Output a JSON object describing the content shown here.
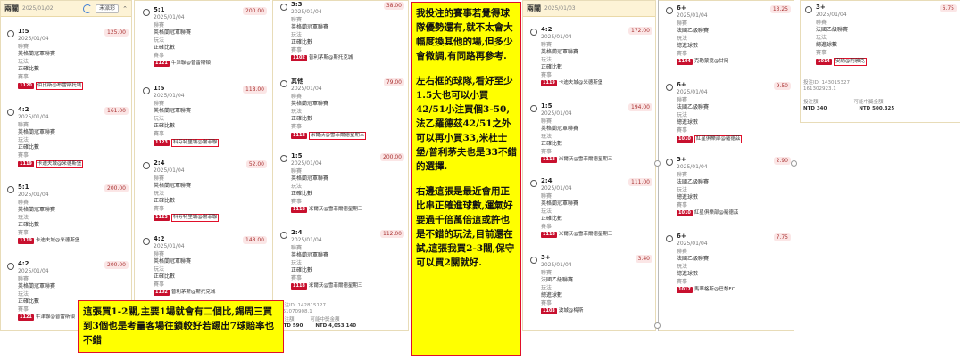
{
  "col1": {
    "title": "兩關",
    "date": "2025/01/02",
    "button": "未派彩",
    "bets": [
      {
        "score": "1:5",
        "date": "2025/01/04",
        "league_label": "聯賽",
        "league": "英格蘭冠軍聯賽",
        "play_label": "玩法",
        "play": "正確比數",
        "match_label": "賽事",
        "match_id": "1120",
        "match": "伯比斯@布雷斯托域",
        "amount": "125.00"
      },
      {
        "score": "4:2",
        "date": "2025/01/04",
        "league_label": "聯賽",
        "league": "英格蘭冠軍聯賽",
        "play_label": "玩法",
        "play": "正確比數",
        "match_label": "賽事",
        "match_id": "1119",
        "match": "卡迪夫城@米德斯堡",
        "amount": "161.00"
      },
      {
        "score": "5:1",
        "date": "2025/01/04",
        "league_label": "聯賽",
        "league": "英格蘭冠軍聯賽",
        "play_label": "玩法",
        "play": "正確比數",
        "match_label": "賽事",
        "match_id": "1119",
        "match": "卡迪夫城@米德斯堡",
        "amount": "200.00"
      },
      {
        "score": "4:2",
        "date": "2025/01/04",
        "league_label": "聯賽",
        "league": "英格蘭冠軍聯賽",
        "play_label": "玩法",
        "play": "正確比數",
        "match_label": "賽事",
        "match_id": "1121",
        "match": "牛津聯@普雷斯頓",
        "amount": "200.00"
      }
    ]
  },
  "col2": {
    "bets": [
      {
        "score": "5:1",
        "date": "2025/01/04",
        "league_label": "聯賽",
        "league": "英格蘭冠軍聯賽",
        "play_label": "玩法",
        "play": "正確比數",
        "match_label": "賽事",
        "match_id": "1121",
        "match": "牛津聯@普雷斯頓",
        "amount": "200.00"
      },
      {
        "score": "1:5",
        "date": "2025/01/04",
        "league_label": "聯賽",
        "league": "英格蘭冠軍聯賽",
        "play_label": "玩法",
        "play": "正確比數",
        "match_label": "賽事",
        "match_id": "1123",
        "match": "科芬特里城@謝菲聯",
        "amount": "118.00"
      },
      {
        "score": "2:4",
        "date": "2025/01/04",
        "league_label": "聯賽",
        "league": "英格蘭冠軍聯賽",
        "play_label": "玩法",
        "play": "正確比數",
        "match_label": "賽事",
        "match_id": "1123",
        "match": "科芬特里城@謝菲聯",
        "amount": "52.00"
      },
      {
        "score": "4:2",
        "date": "2025/01/04",
        "league_label": "聯賽",
        "league": "英格蘭冠軍聯賽",
        "play_label": "玩法",
        "play": "正確比數",
        "match_label": "賽事",
        "match_id": "1102",
        "match": "普利茅斯@斯托克城",
        "amount": "148.00"
      }
    ]
  },
  "col3": {
    "bets": [
      {
        "score": "3:3",
        "date": "2025/01/04",
        "league_label": "聯賽",
        "league": "英格蘭冠軍聯賽",
        "play_label": "玩法",
        "play": "正確比數",
        "match_label": "賽事",
        "match_id": "1102",
        "match": "普利茅斯@斯托克城",
        "amount": "38.00"
      },
      {
        "score": "其他",
        "date": "2025/01/04",
        "league_label": "聯賽",
        "league": "英格蘭冠軍聯賽",
        "play_label": "玩法",
        "play": "正確比數",
        "match_label": "賽事",
        "match_id": "1118",
        "match": "米爾沃@雪菲爾德星期三",
        "amount": "79.00"
      },
      {
        "score": "1:5",
        "date": "2025/01/04",
        "league_label": "聯賽",
        "league": "英格蘭冠軍聯賽",
        "play_label": "玩法",
        "play": "正確比數",
        "match_label": "賽事",
        "match_id": "1118",
        "match": "米爾沃@雪菲爾德星期三",
        "amount": "200.00"
      },
      {
        "score": "2:4",
        "date": "2025/01/04",
        "league_label": "聯賽",
        "league": "英格蘭冠軍聯賽",
        "play_label": "玩法",
        "play": "正確比數",
        "match_label": "賽事",
        "match_id": "1118",
        "match": "米爾沃@雪菲爾德星期三",
        "amount": "112.00"
      }
    ],
    "footer": {
      "id_label": "投注ID:",
      "id1": "142815127",
      "id2": "161070908.1",
      "stake_label": "投注額",
      "stake": "NTD 590",
      "win_label": "可能中獎金額",
      "win": "NTD 4,053.140"
    }
  },
  "col4": {
    "title": "兩關",
    "date": "2025/01/03",
    "button": "未派彩",
    "bets": [
      {
        "score": "4:2",
        "date": "2025/01/04",
        "league_label": "聯賽",
        "league": "英格蘭冠軍聯賽",
        "play_label": "玩法",
        "play": "正確比數",
        "match_label": "賽事",
        "match_id": "1119",
        "match": "卡迪夫城@米德斯堡",
        "amount": "172.00"
      },
      {
        "score": "1:5",
        "date": "2025/01/04",
        "league_label": "聯賽",
        "league": "英格蘭冠軍聯賽",
        "play_label": "玩法",
        "play": "正確比數",
        "match_label": "賽事",
        "match_id": "1118",
        "match": "米爾沃@雪菲爾德星期三",
        "amount": "194.00"
      },
      {
        "score": "2:4",
        "date": "2025/01/04",
        "league_label": "聯賽",
        "league": "英格蘭冠軍聯賽",
        "play_label": "玩法",
        "play": "正確比數",
        "match_label": "賽事",
        "match_id": "1118",
        "match": "米爾沃@雪菲爾德星期三",
        "amount": "111.00"
      },
      {
        "score": "3+",
        "date": "2025/01/04",
        "league_label": "聯賽",
        "league": "法國乙級聯賽",
        "play_label": "玩法",
        "play": "總進球數",
        "match_label": "賽事",
        "match_id": "1103",
        "match": "波城@梅斯",
        "amount": "3.40"
      }
    ]
  },
  "col5": {
    "bets": [
      {
        "score": "6+",
        "date": "2025/01/04",
        "league_label": "聯賽",
        "league": "法國乙級聯賽",
        "play_label": "玩法",
        "play": "總進球數",
        "match_label": "賽事",
        "match_id": "1104",
        "match": "克勒蒙竟@甘岡",
        "amount": "13.25"
      },
      {
        "score": "6+",
        "date": "2025/01/04",
        "league_label": "聯賽",
        "league": "法國乙級聯賽",
        "play_label": "玩法",
        "play": "總進球數",
        "match_label": "賽事",
        "match_id": "1010",
        "match": "紅星俱樂部@羅德茲",
        "amount": "9.50"
      },
      {
        "score": "3+",
        "date": "2025/01/04",
        "league_label": "聯賽",
        "league": "法國乙級聯賽",
        "play_label": "玩法",
        "play": "總進球數",
        "match_label": "賽事",
        "match_id": "1010",
        "match": "紅星俱樂部@羅德茲",
        "amount": "2.90"
      },
      {
        "score": "6+",
        "date": "2025/01/04",
        "league_label": "聯賽",
        "league": "法國乙級聯賽",
        "play_label": "玩法",
        "play": "總進球數",
        "match_label": "賽事",
        "match_id": "1017",
        "match": "馬蒂格斯@巴黎FC",
        "amount": "7.75"
      }
    ]
  },
  "col6": {
    "bets": [
      {
        "score": "3+",
        "date": "2025/01/04",
        "league_label": "聯賽",
        "league": "法國乙級聯賽",
        "play_label": "玩法",
        "play": "總進球數",
        "match_label": "賽事",
        "match_id": "1014",
        "match": "安納@阿雅克",
        "amount": "6.75"
      }
    ],
    "footer": {
      "id_label": "投注ID:",
      "id1": "143015327",
      "id2": "161302923.1",
      "stake_label": "投注額",
      "stake": "NTD 340",
      "win_label": "可能中獎金額",
      "win": "NTD 500,325"
    }
  },
  "notes": {
    "center_p1": "我投注的賽事若覺得球隊優勢還有,就不太會大幅度換其他的場,但多少會微調,有同路再參考.",
    "center_p2": "左右框的球隊,看好至少1.5大也可以小買42/51小注買個3-50,法乙羅德茲42/51之外可以再小買33,米杜士堡/普利茅夫也是33不錯的選擇.",
    "center_p3": "右邊這張是最近會用正比串正確進球數,運氣好要過千倍萬倍這或許也是不錯的玩法,目前還在試,這張我買2-3關,保守可以買2關就好.",
    "bottom": "這張買1-2關,主要1場就會有二個比,錫周三買到3個也是考量客場往鎖較好若踢出7球賠率也不錯"
  }
}
